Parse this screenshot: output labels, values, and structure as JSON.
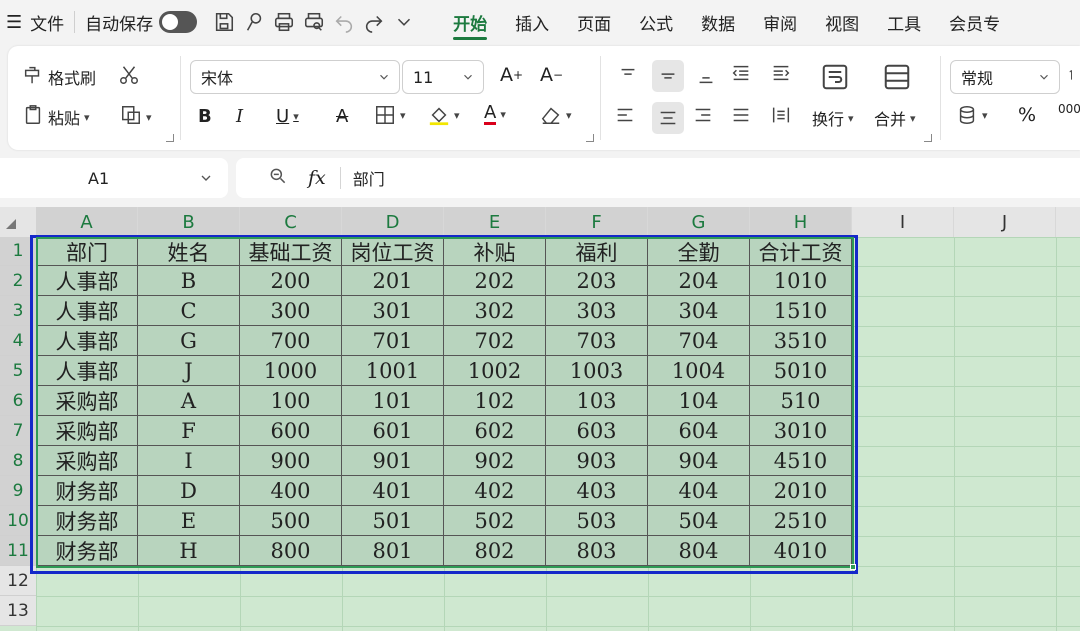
{
  "menubar": {
    "file_label": "文件",
    "autosave_label": "自动保存",
    "tabs": [
      "开始",
      "插入",
      "页面",
      "公式",
      "数据",
      "审阅",
      "视图",
      "工具",
      "会员专"
    ]
  },
  "ribbon": {
    "format_painter": "格式刷",
    "paste": "粘贴",
    "font_name": "宋体",
    "font_size": "11",
    "wrap_text": "换行",
    "merge": "合并",
    "number_format": "常规",
    "percent": "%",
    "thousands": "000"
  },
  "formula_bar": {
    "name_box": "A1",
    "fx_label": "fx",
    "content": "部门"
  },
  "sheet": {
    "columns": [
      "A",
      "B",
      "C",
      "D",
      "E",
      "F",
      "G",
      "H",
      "I",
      "J"
    ],
    "rows": [
      "1",
      "2",
      "3",
      "4",
      "5",
      "6",
      "7",
      "8",
      "9",
      "10",
      "11",
      "12",
      "13"
    ],
    "table": [
      [
        "部门",
        "姓名",
        "基础工资",
        "岗位工资",
        "补贴",
        "福利",
        "全勤",
        "合计工资"
      ],
      [
        "人事部",
        "B",
        "200",
        "201",
        "202",
        "203",
        "204",
        "1010"
      ],
      [
        "人事部",
        "C",
        "300",
        "301",
        "302",
        "303",
        "304",
        "1510"
      ],
      [
        "人事部",
        "G",
        "700",
        "701",
        "702",
        "703",
        "704",
        "3510"
      ],
      [
        "人事部",
        "J",
        "1000",
        "1001",
        "1002",
        "1003",
        "1004",
        "5010"
      ],
      [
        "采购部",
        "A",
        "100",
        "101",
        "102",
        "103",
        "104",
        "510"
      ],
      [
        "采购部",
        "F",
        "600",
        "601",
        "602",
        "603",
        "604",
        "3010"
      ],
      [
        "采购部",
        "I",
        "900",
        "901",
        "902",
        "903",
        "904",
        "4510"
      ],
      [
        "财务部",
        "D",
        "400",
        "401",
        "402",
        "403",
        "404",
        "2010"
      ],
      [
        "财务部",
        "E",
        "500",
        "501",
        "502",
        "503",
        "504",
        "2510"
      ],
      [
        "财务部",
        "H",
        "800",
        "801",
        "802",
        "803",
        "804",
        "4010"
      ]
    ]
  },
  "colors": {
    "accent": "#1c7a3f",
    "selection_border": "#1428c9",
    "data_fill": "#b8d4be",
    "sheet_fill": "#cfe8d0"
  }
}
